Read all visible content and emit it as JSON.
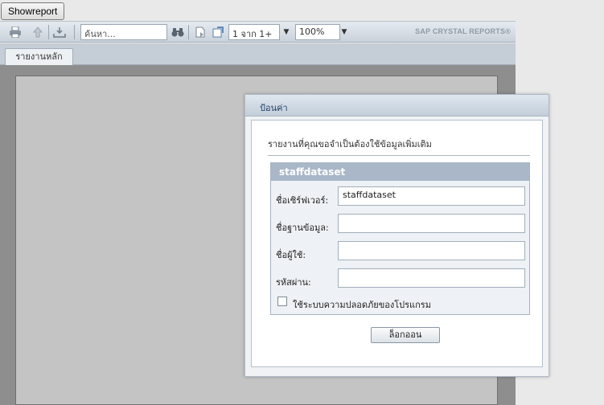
{
  "showreport_label": "Showreport",
  "toolbar": {
    "icons": [
      "printer-icon",
      "upload-icon",
      "export-icon",
      "binoculars-icon",
      "page-icon",
      "refresh-icon"
    ],
    "search_placeholder": "ค้นหา...",
    "page_value": "1 จาก 1+",
    "zoom_value": "100%",
    "brand": "SAP CRYSTAL REPORTS®"
  },
  "tabs": [
    {
      "label": "รายงานหลัก"
    }
  ],
  "dialog": {
    "title": "ป้อนค่า",
    "message": "รายงานที่คุณขอจำเป็นต้องใช้ข้อมูลเพิ่มเติม",
    "group_title": "staffdataset",
    "fields": [
      {
        "label": "ชื่อเซิร์ฟเวอร์:",
        "value": "staffdataset"
      },
      {
        "label": "ชื่อฐานข้อมูล:",
        "value": ""
      },
      {
        "label": "ชื่อผู้ใช้:",
        "value": ""
      },
      {
        "label": "รหัสผ่าน:",
        "value": ""
      }
    ],
    "checkbox_label": "ใช้ระบบความปลอดภัยของโปรแกรม",
    "login_label": "ล็อกออน"
  }
}
